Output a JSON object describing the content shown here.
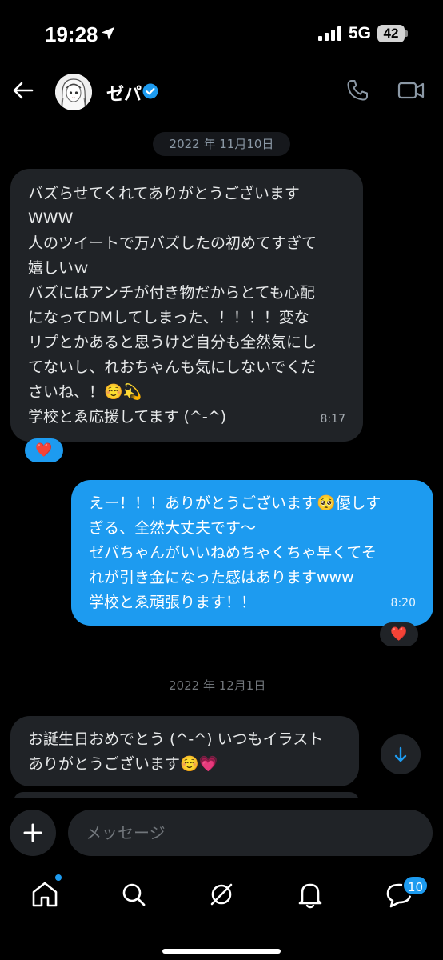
{
  "status_bar": {
    "time": "19:28",
    "network": "5G",
    "battery": "42"
  },
  "header": {
    "name": "ゼパ"
  },
  "messages": [
    {
      "type": "date",
      "text": "2022 年 11月10日"
    },
    {
      "type": "incoming",
      "text": "バズらせてくれてありがとうございます\nWWW\n人のツイートで万バズしたの初めてすぎて\n嬉しいｗ\nバズにはアンチが付き物だからとても心配\nになってDMしてしまった、！！！！変な\nリプとかあると思うけど自分も全然気にし\nてないし、れおちゃんも気にしないでくだ\nさいね、！☺️💫\n学校とゑ応援してます (^-^)",
      "time": "8:17",
      "reaction": "❤️"
    },
    {
      "type": "outgoing",
      "text": "えー！！！ありがとうございます🥺優しす\nぎる、全然大丈夫です〜\nゼパちゃんがいいねめちゃくちゃ早くてそ\nれが引き金になった感はありますwww\n学校とゑ頑張ります！！",
      "time": "8:20",
      "reaction": "❤️"
    },
    {
      "type": "date",
      "text": "2022 年 12月1日"
    },
    {
      "type": "incoming",
      "text": "お誕生日おめでとう (^-^) いつもイラスト\nありがとうございます☺️💗"
    }
  ],
  "composer": {
    "placeholder": "メッセージ"
  },
  "bottom_nav": {
    "items": [
      "home-icon",
      "search-icon",
      "grok-icon",
      "notifications-icon",
      "messages-icon"
    ],
    "messages_badge": "10"
  },
  "colors": {
    "accent": "#1d9bf0",
    "bubble_in": "#202327",
    "background": "#000000"
  }
}
